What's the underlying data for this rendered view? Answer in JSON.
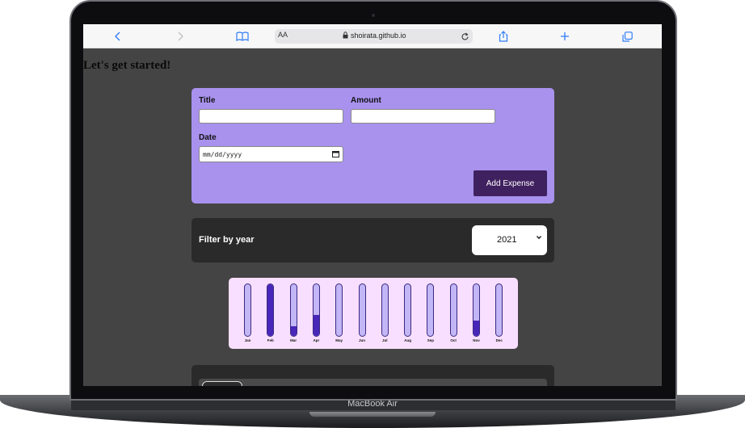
{
  "device": {
    "label": "MacBook Air"
  },
  "browser": {
    "reader_mode_label": "AA",
    "url": "shoirata.github.io",
    "icons": [
      "back-icon",
      "forward-icon",
      "bookmarks-icon",
      "lock-icon",
      "reload-icon",
      "share-icon",
      "new-tab-icon",
      "tabs-icon"
    ]
  },
  "page": {
    "title": "Let's get started!"
  },
  "form": {
    "title_label": "Title",
    "title_value": "",
    "amount_label": "Amount",
    "amount_value": "",
    "date_label": "Date",
    "date_placeholder": "mm/dd/yyyy",
    "submit_label": "Add Expense"
  },
  "filter": {
    "label": "Filter by year",
    "selected_year": "2021"
  },
  "chart_data": {
    "type": "bar",
    "categories": [
      "Jan",
      "Feb",
      "Mar",
      "Apr",
      "May",
      "Jun",
      "Jul",
      "Aug",
      "Sep",
      "Oct",
      "Nov",
      "Dec"
    ],
    "values": [
      0,
      1.0,
      0.18,
      0.4,
      0,
      0,
      0,
      0,
      0,
      0,
      0.3,
      0
    ],
    "ylim": [
      0,
      1
    ],
    "colors": {
      "fill": "#4826b9",
      "track": "#c3b6f7",
      "background": "#f8dfff"
    }
  },
  "colors": {
    "form_background": "#a892ee",
    "button_background": "#40215f",
    "card_background": "#2a2a2a",
    "page_background": "#444444"
  }
}
